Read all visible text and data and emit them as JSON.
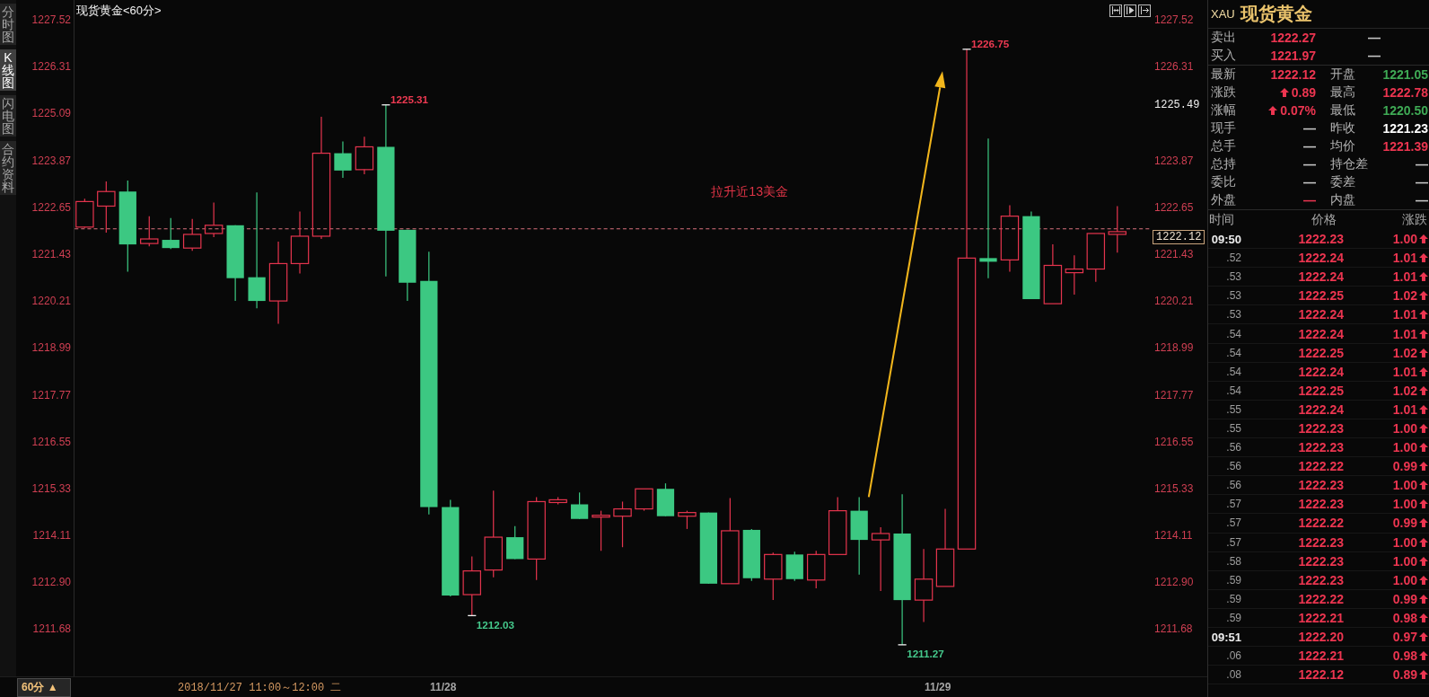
{
  "sidebar": {
    "tabs": [
      {
        "label": "分时图",
        "selected": false
      },
      {
        "label": "K线图",
        "selected": true
      },
      {
        "label": "闪电图",
        "selected": false
      },
      {
        "label": "合约资料",
        "selected": false
      }
    ]
  },
  "chart": {
    "title": "现货黄金<60分>",
    "left_axis": [
      "1227.52",
      "1226.31",
      "1225.09",
      "1223.87",
      "1222.65",
      "1221.43",
      "1220.21",
      "1218.99",
      "1217.77",
      "1216.55",
      "1215.33",
      "1214.11",
      "1212.90",
      "1211.68"
    ],
    "right_axis": [
      {
        "text": "1227.52",
        "kind": "tick"
      },
      {
        "text": "1226.31",
        "kind": "tick"
      },
      {
        "text": "1225.49",
        "kind": "marker"
      },
      {
        "text": "1223.87",
        "kind": "tick"
      },
      {
        "text": "1222.65",
        "kind": "tick"
      },
      {
        "text": "1221.43",
        "kind": "tick"
      },
      {
        "text": "1220.21",
        "kind": "tick"
      },
      {
        "text": "1218.99",
        "kind": "tick"
      },
      {
        "text": "1217.77",
        "kind": "tick"
      },
      {
        "text": "1216.55",
        "kind": "tick"
      },
      {
        "text": "1215.33",
        "kind": "tick"
      },
      {
        "text": "1214.11",
        "kind": "tick"
      },
      {
        "text": "1212.90",
        "kind": "tick"
      },
      {
        "text": "1211.68",
        "kind": "tick"
      }
    ],
    "last_price": "1222.12",
    "extremes": [
      {
        "text": "1225.31",
        "kind": "high"
      },
      {
        "text": "1212.03",
        "kind": "low"
      },
      {
        "text": "1211.27",
        "kind": "low"
      },
      {
        "text": "1226.75",
        "kind": "high"
      }
    ],
    "callout": "拉升近13美金"
  },
  "bottom_bar": {
    "period": "60分 ▲",
    "cursor_time": "2018/11/27 11:00～12:00 二",
    "dates": [
      "11/28",
      "11/29"
    ]
  },
  "quote": {
    "symbol": "XAU",
    "name": "现货黄金",
    "bid_ask": [
      {
        "label": "卖出",
        "price": "1222.27",
        "volume": "—"
      },
      {
        "label": "买入",
        "price": "1221.97",
        "volume": "—"
      }
    ],
    "stats": [
      {
        "label": "最新",
        "value": "1222.12",
        "color": "#ec3550"
      },
      {
        "label": "开盘",
        "value": "1221.05",
        "color": "#3faa55"
      },
      {
        "label": "涨跌",
        "value": "0.89",
        "color": "#ec3550",
        "rising": true
      },
      {
        "label": "最高",
        "value": "1222.78",
        "color": "#ec3550"
      },
      {
        "label": "涨幅",
        "value": "0.07%",
        "color": "#ec3550",
        "rising": true
      },
      {
        "label": "最低",
        "value": "1220.50",
        "color": "#3faa55"
      },
      {
        "label": "现手",
        "value": "—",
        "color": "#c8c8c8"
      },
      {
        "label": "昨收",
        "value": "1221.23",
        "color": "#ffffff"
      },
      {
        "label": "总手",
        "value": "—",
        "color": "#c8c8c8"
      },
      {
        "label": "均价",
        "value": "1221.39",
        "color": "#ec3550"
      },
      {
        "label": "总持",
        "value": "—",
        "color": "#c8c8c8"
      },
      {
        "label": "持仓差",
        "value": "—",
        "color": "#c8c8c8"
      },
      {
        "label": "委比",
        "value": "—",
        "color": "#c8c8c8"
      },
      {
        "label": "委差",
        "value": "—",
        "color": "#c8c8c8"
      },
      {
        "label": "外盘",
        "value": "—",
        "color": "#ec3550"
      },
      {
        "label": "内盘",
        "value": "—",
        "color": "#c8c8c8"
      }
    ]
  },
  "ticks": {
    "columns": [
      "时间",
      "价格",
      "涨跌"
    ],
    "rows": [
      {
        "time": "09:50",
        "kind": "minute",
        "price": "1222.23",
        "change": "1.00",
        "rising": true
      },
      {
        "time": ".52",
        "kind": "second",
        "price": "1222.24",
        "change": "1.01",
        "rising": true
      },
      {
        "time": ".53",
        "kind": "second",
        "price": "1222.24",
        "change": "1.01",
        "rising": true
      },
      {
        "time": ".53",
        "kind": "second",
        "price": "1222.25",
        "change": "1.02",
        "rising": true
      },
      {
        "time": ".53",
        "kind": "second",
        "price": "1222.24",
        "change": "1.01",
        "rising": true
      },
      {
        "time": ".54",
        "kind": "second",
        "price": "1222.24",
        "change": "1.01",
        "rising": true
      },
      {
        "time": ".54",
        "kind": "second",
        "price": "1222.25",
        "change": "1.02",
        "rising": true
      },
      {
        "time": ".54",
        "kind": "second",
        "price": "1222.24",
        "change": "1.01",
        "rising": true
      },
      {
        "time": ".54",
        "kind": "second",
        "price": "1222.25",
        "change": "1.02",
        "rising": true
      },
      {
        "time": ".55",
        "kind": "second",
        "price": "1222.24",
        "change": "1.01",
        "rising": true
      },
      {
        "time": ".55",
        "kind": "second",
        "price": "1222.23",
        "change": "1.00",
        "rising": true
      },
      {
        "time": ".56",
        "kind": "second",
        "price": "1222.23",
        "change": "1.00",
        "rising": true
      },
      {
        "time": ".56",
        "kind": "second",
        "price": "1222.22",
        "change": "0.99",
        "rising": true
      },
      {
        "time": ".56",
        "kind": "second",
        "price": "1222.23",
        "change": "1.00",
        "rising": true
      },
      {
        "time": ".57",
        "kind": "second",
        "price": "1222.23",
        "change": "1.00",
        "rising": true
      },
      {
        "time": ".57",
        "kind": "second",
        "price": "1222.22",
        "change": "0.99",
        "rising": true
      },
      {
        "time": ".57",
        "kind": "second",
        "price": "1222.23",
        "change": "1.00",
        "rising": true
      },
      {
        "time": ".58",
        "kind": "second",
        "price": "1222.23",
        "change": "1.00",
        "rising": true
      },
      {
        "time": ".59",
        "kind": "second",
        "price": "1222.23",
        "change": "1.00",
        "rising": true
      },
      {
        "time": ".59",
        "kind": "second",
        "price": "1222.22",
        "change": "0.99",
        "rising": true
      },
      {
        "time": ".59",
        "kind": "second",
        "price": "1222.21",
        "change": "0.98",
        "rising": true
      },
      {
        "time": "09:51",
        "kind": "minute",
        "price": "1222.20",
        "change": "0.97",
        "rising": true
      },
      {
        "time": ".06",
        "kind": "second",
        "price": "1222.21",
        "change": "0.98",
        "rising": true
      },
      {
        "time": ".08",
        "kind": "second",
        "price": "1222.12",
        "change": "0.89",
        "rising": true
      }
    ]
  }
}
